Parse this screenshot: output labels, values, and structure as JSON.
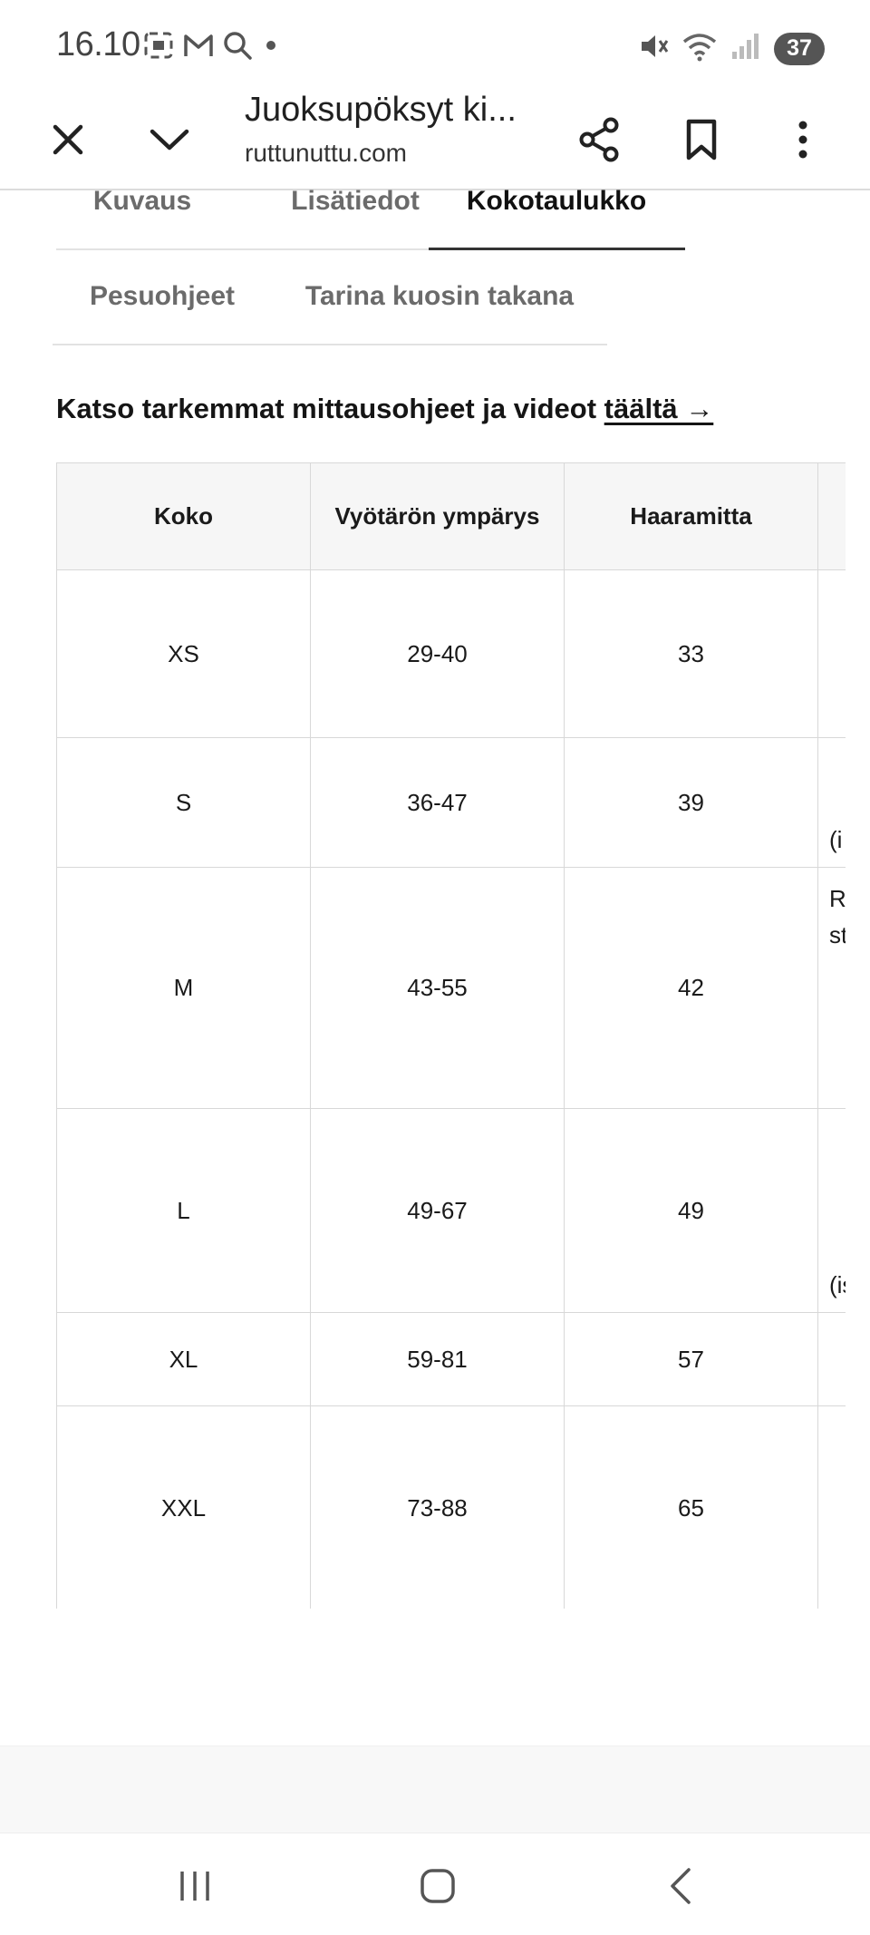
{
  "status_bar": {
    "time": "16.10",
    "battery": "37",
    "icons": [
      "screenshot-icon",
      "gmail-icon",
      "search-icon",
      "notification-dot-icon",
      "mute-icon",
      "wifi-icon",
      "signal-icon"
    ]
  },
  "toolbar": {
    "title": "Juoksupöksyt ki...",
    "url": "ruttunuttu.com",
    "icons": [
      "close-icon",
      "chevron-down-icon",
      "share-icon",
      "bookmark-icon",
      "more-vert-icon"
    ]
  },
  "tabs_row1": [
    {
      "label": "Kuvaus",
      "active": false
    },
    {
      "label": "Lisätiedot",
      "active": false
    },
    {
      "label": "Kokotaulukko",
      "active": true
    }
  ],
  "tabs_row2": [
    {
      "label": "Pesuohjeet",
      "active": false
    },
    {
      "label": "Tarina kuosin takana",
      "active": false
    }
  ],
  "intro": {
    "text": "Katso tarkemmat mittausohjeet ja videot ",
    "link": "täältä →"
  },
  "size_table": {
    "headers": [
      "Koko",
      "Vyötärön ympärys",
      "Haaramitta"
    ],
    "rows": [
      {
        "size": "XS",
        "waist": "29-40",
        "crotch": "33",
        "extra": [
          "",
          ""
        ]
      },
      {
        "size": "S",
        "waist": "36-47",
        "crotch": "39",
        "extra": [
          "",
          "(i"
        ]
      },
      {
        "size": "M",
        "waist": "43-55",
        "crotch": "42",
        "extra": [
          "R",
          "st"
        ]
      },
      {
        "size": "L",
        "waist": "49-67",
        "crotch": "49",
        "extra": [
          "",
          "(is"
        ]
      },
      {
        "size": "XL",
        "waist": "59-81",
        "crotch": "57",
        "extra": [
          "",
          ""
        ]
      },
      {
        "size": "XXL",
        "waist": "73-88",
        "crotch": "65",
        "extra": [
          "",
          ""
        ]
      }
    ]
  },
  "nav_bar": {
    "icons": [
      "recent-apps-icon",
      "home-icon",
      "back-icon"
    ]
  }
}
